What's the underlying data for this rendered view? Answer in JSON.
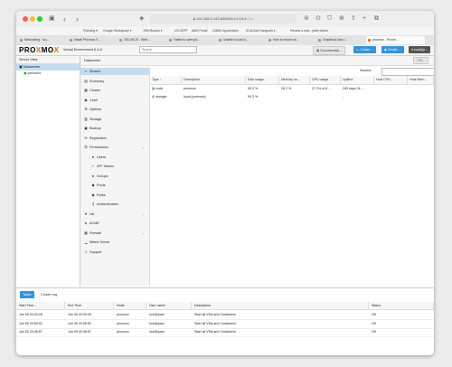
{
  "browser": {
    "url": "192.168.0.143:8006/#v1:0:18:4:::::::",
    "bookmarks": [
      "Planning ▾",
      "Google Workspace ▾",
      "JIRA Boards ▾",
      "US-CERT",
      "AWS Portal",
      "CMMC Appendices",
      "SCat Add Hangouts ▾",
      "Review a host...plete sticker"
    ],
    "tabs": [
      "Networking - roo...",
      "Install Proxmox V...",
      "200-VECE - Web...",
      "Failed to open pa...",
      "Unable to load a...",
      "How to mount an...",
      "Graphical User I...",
      "proxmox - Proxm..."
    ]
  },
  "header": {
    "logo_a": "PRO",
    "logo_x": "X",
    "logo_b": "MO",
    "logo_c": "X",
    "version": "Virtual Environment 6.4-8",
    "search_placeholder": "Search",
    "documentation": "Documentati...",
    "create_vm": "Create ...",
    "create_ct": "Create ...",
    "user": "root@p..."
  },
  "left": {
    "header": "Server View",
    "items": [
      "Datacenter",
      "proxmox"
    ]
  },
  "main": {
    "breadcrumb": "Datacenter",
    "help": "H...",
    "search_label": "Search:"
  },
  "nav": [
    {
      "label": "Search",
      "icon": "search-icon",
      "glyph": "⌕"
    },
    {
      "label": "Summary",
      "icon": "summary-icon",
      "glyph": "▤"
    },
    {
      "label": "Cluster",
      "icon": "cluster-icon",
      "glyph": "▦"
    },
    {
      "label": "Ceph",
      "icon": "ceph-icon",
      "glyph": "◉"
    },
    {
      "label": "Options",
      "icon": "gear-icon",
      "glyph": "⚙"
    },
    {
      "label": "Storage",
      "icon": "storage-icon",
      "glyph": "▥"
    },
    {
      "label": "Backup",
      "icon": "backup-icon",
      "glyph": "▣"
    },
    {
      "label": "Replication",
      "icon": "replication-icon",
      "glyph": "⟳"
    },
    {
      "label": "Permissions",
      "icon": "permissions-icon",
      "glyph": "⚿"
    },
    {
      "label": "Users",
      "icon": "user-icon",
      "glyph": "●"
    },
    {
      "label": "API Tokens",
      "icon": "api-token-icon",
      "glyph": "⌐"
    },
    {
      "label": "Groups",
      "icon": "groups-icon",
      "glyph": "●"
    },
    {
      "label": "Pools",
      "icon": "pools-icon",
      "glyph": "◆"
    },
    {
      "label": "Roles",
      "icon": "roles-icon",
      "glyph": "◆"
    },
    {
      "label": "Authentication",
      "icon": "key-icon",
      "glyph": "⚷"
    },
    {
      "label": "HA",
      "icon": "ha-icon",
      "glyph": "♥"
    },
    {
      "label": "ACME",
      "icon": "acme-icon",
      "glyph": "●"
    },
    {
      "label": "Firewall",
      "icon": "firewall-icon",
      "glyph": "▦"
    },
    {
      "label": "Metric Server",
      "icon": "metric-icon",
      "glyph": "▁"
    },
    {
      "label": "Support",
      "icon": "support-icon",
      "glyph": "☺"
    }
  ],
  "grid": {
    "columns": [
      "Type ↑",
      "Description",
      "Disk usage...",
      "Memory us...",
      "CPU usage",
      "Uptime",
      "Host CPU...",
      "Host Mem..."
    ],
    "rows": [
      [
        "node",
        "proxmox",
        "90.3 %",
        "26.2 %",
        "27.2% of 8 ...",
        "245 days 01:...",
        "",
        ""
      ],
      [
        "storage",
        "local (proxmox)",
        "90.3 %",
        "",
        "",
        "-",
        "",
        ""
      ]
    ]
  },
  "bottom": {
    "tabs": [
      "Tasks",
      "Cluster log"
    ],
    "columns": [
      "Start Time ↓",
      "End Time",
      "Node",
      "User name",
      "Description",
      "Status"
    ],
    "rows": [
      [
        "Jun 06 00:00:28",
        "Jun 06 00:00:28",
        "proxmox",
        "root@pam",
        "Start all VMs and Containers",
        "OK"
      ],
      [
        "Jun 05 23:59:52",
        "Jun 05 23:59:52",
        "proxmox",
        "root@pam",
        "Start all VMs and Containers",
        "OK"
      ],
      [
        "Jun 05 23:46:57",
        "Jun 05 23:46:57",
        "proxmox",
        "root@pam",
        "Start all VMs and Containers",
        "OK"
      ]
    ]
  }
}
